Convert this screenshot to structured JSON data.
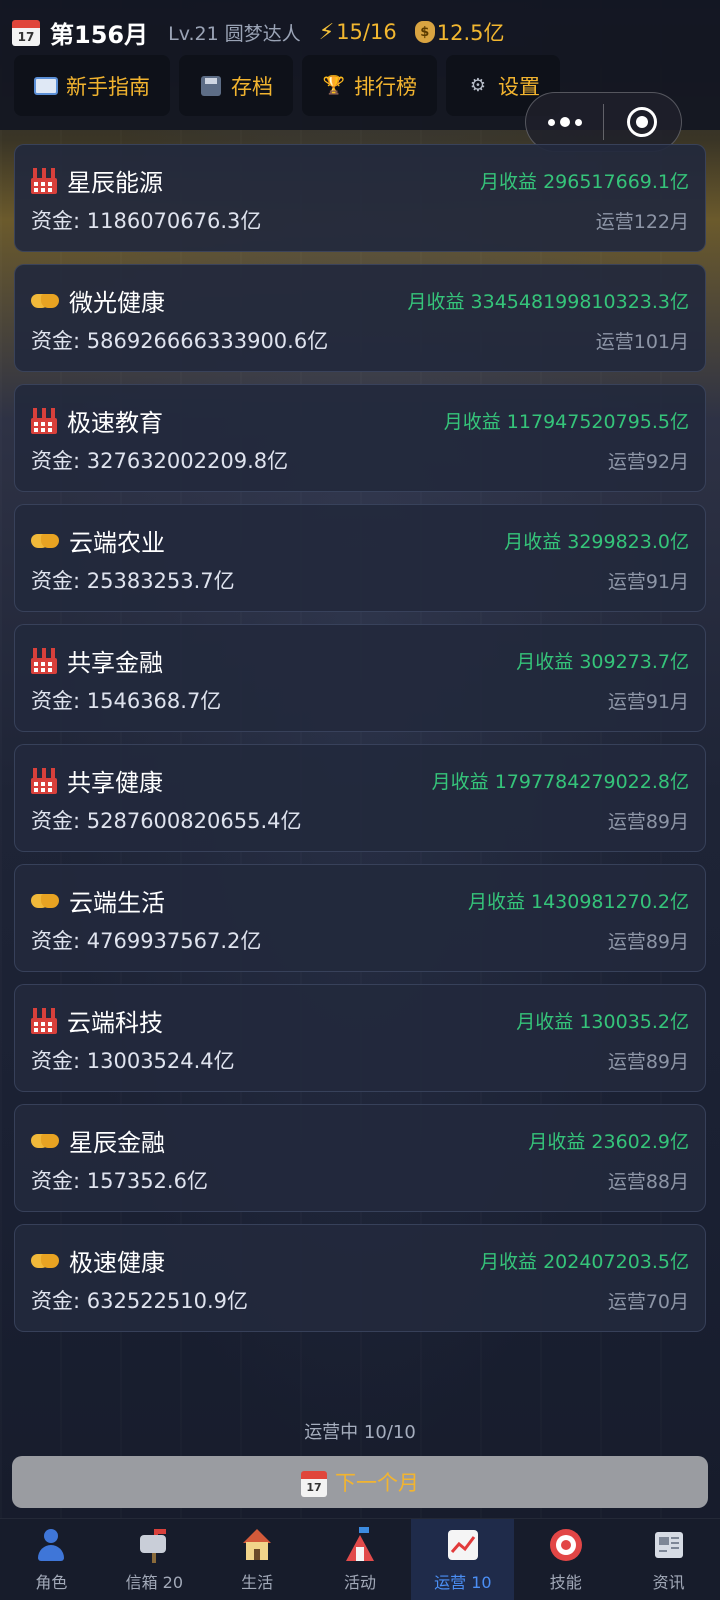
{
  "header": {
    "calendar_day": "17",
    "month": "第156月",
    "level": "Lv.21 圆梦达人",
    "energy": "15/16",
    "money": "12.5亿"
  },
  "menu": [
    {
      "label": "新手指南",
      "icon": "book-icon"
    },
    {
      "label": "存档",
      "icon": "floppy-icon"
    },
    {
      "label": "排行榜",
      "icon": "trophy-icon"
    },
    {
      "label": "设置",
      "icon": "gear-icon"
    }
  ],
  "businesses": [
    {
      "name": "星辰能源",
      "icon": "factory-icon",
      "fund": "资金: 1186070676.3亿",
      "income": "月收益 296517669.1亿",
      "months": "运营122月"
    },
    {
      "name": "微光健康",
      "icon": "handshake-icon",
      "fund": "资金: 586926666333900.6亿",
      "income": "月收益 334548199810323.3亿",
      "months": "运营101月"
    },
    {
      "name": "极速教育",
      "icon": "factory-icon",
      "fund": "资金: 327632002209.8亿",
      "income": "月收益 117947520795.5亿",
      "months": "运营92月"
    },
    {
      "name": "云端农业",
      "icon": "handshake-icon",
      "fund": "资金: 25383253.7亿",
      "income": "月收益 3299823.0亿",
      "months": "运营91月"
    },
    {
      "name": "共享金融",
      "icon": "factory-icon",
      "fund": "资金: 1546368.7亿",
      "income": "月收益 309273.7亿",
      "months": "运营91月"
    },
    {
      "name": "共享健康",
      "icon": "factory-icon",
      "fund": "资金: 5287600820655.4亿",
      "income": "月收益 1797784279022.8亿",
      "months": "运营89月"
    },
    {
      "name": "云端生活",
      "icon": "handshake-icon",
      "fund": "资金: 4769937567.2亿",
      "income": "月收益 1430981270.2亿",
      "months": "运营89月"
    },
    {
      "name": "云端科技",
      "icon": "factory-icon",
      "fund": "资金: 13003524.4亿",
      "income": "月收益 130035.2亿",
      "months": "运营89月"
    },
    {
      "name": "星辰金融",
      "icon": "handshake-icon",
      "fund": "资金: 157352.6亿",
      "income": "月收益 23602.9亿",
      "months": "运营88月"
    },
    {
      "name": "极速健康",
      "icon": "handshake-icon",
      "fund": "资金: 632522510.9亿",
      "income": "月收益 202407203.5亿",
      "months": "运营70月"
    }
  ],
  "operating_count": "运营中 10/10",
  "next_month_label": "下一个月",
  "tabs": [
    {
      "label": "角色",
      "icon": "person-icon"
    },
    {
      "label": "信箱 20",
      "icon": "mailbox-icon"
    },
    {
      "label": "生活",
      "icon": "house-icon"
    },
    {
      "label": "活动",
      "icon": "tent-icon"
    },
    {
      "label": "运营 10",
      "icon": "chart-icon",
      "active": true
    },
    {
      "label": "技能",
      "icon": "target-icon"
    },
    {
      "label": "资讯",
      "icon": "newspaper-icon"
    }
  ],
  "colors": {
    "accent_gold": "#f2b42f",
    "income_green": "#35c47a",
    "active_tab_blue": "#4b8ff5"
  }
}
